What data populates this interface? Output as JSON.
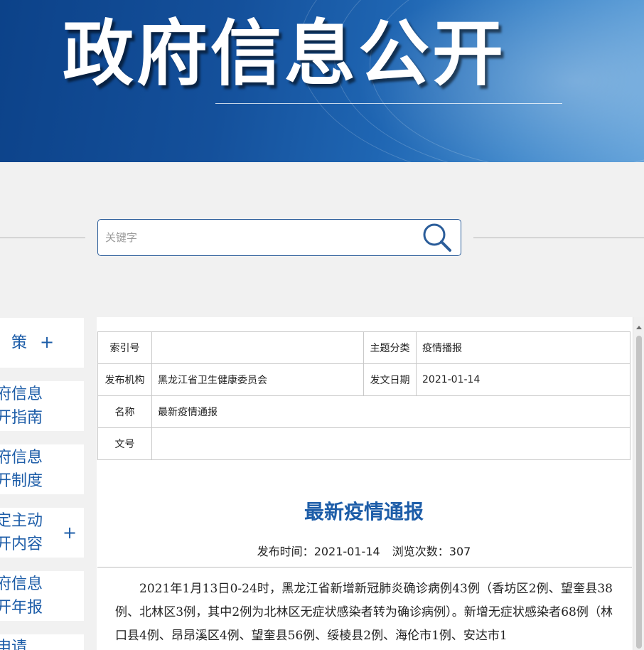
{
  "banner": {
    "title": "政府信息公开"
  },
  "search": {
    "placeholder": "关键字"
  },
  "nav": {
    "item1": {
      "label": "策",
      "plus": "+"
    },
    "item2": {
      "line1": "府信息",
      "line2": "开指南"
    },
    "item3": {
      "line1": "府信息",
      "line2": "开制度"
    },
    "item4": {
      "line1": "定主动",
      "line2": "开内容",
      "plus": "+"
    },
    "item5": {
      "line1": "府信息",
      "line2": "开年报"
    },
    "item6": {
      "line1": "申请"
    }
  },
  "meta_table": {
    "index_label": "索引号",
    "index_value": "",
    "category_label": "主题分类",
    "category_value": "疫情播报",
    "publisher_label": "发布机构",
    "publisher_value": "黑龙江省卫生健康委员会",
    "date_label": "发文日期",
    "date_value": "2021-01-14",
    "name_label": "名称",
    "name_value": "最新疫情通报",
    "docno_label": "文号",
    "docno_value": ""
  },
  "article": {
    "title": "最新疫情通报",
    "publish_label": "发布时间：",
    "publish_date": "2021-01-14",
    "views_label": "浏览次数：",
    "views": "307",
    "body": "2021年1月13日0-24时，黑龙江省新增新冠肺炎确诊病例43例（香坊区2例、望奎县38例、北林区3例，其中2例为北林区无症状感染者转为确诊病例）。新增无症状感染者68例（林口县4例、昂昂溪区4例、望奎县56例、绥棱县2例、海伦市1例、安达市1"
  },
  "colors": {
    "brand_blue": "#1d5da8",
    "banner_dark": "#0c4289"
  }
}
